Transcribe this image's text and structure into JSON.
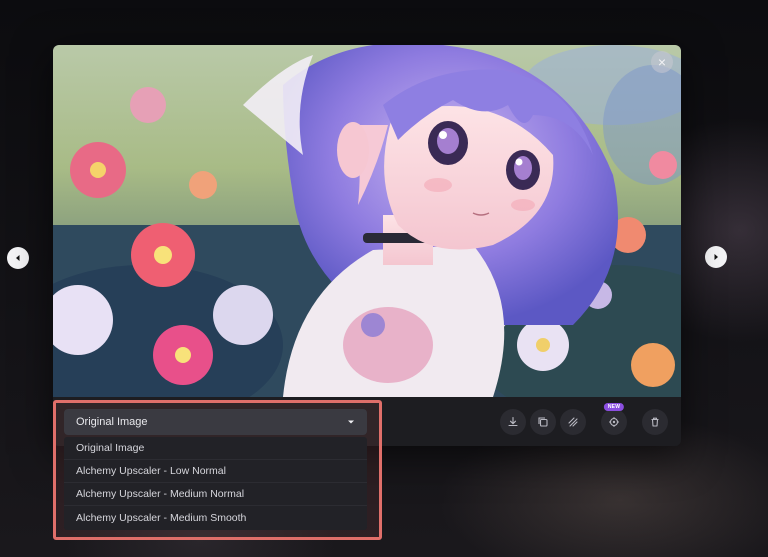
{
  "viewer": {
    "close_label": "×",
    "new_badge": "NEW",
    "icons": [
      "download-icon",
      "copy-icon",
      "remove-background-icon",
      "unzoom-icon",
      "trash-icon"
    ]
  },
  "upscale_dropdown": {
    "selected": "Original Image",
    "options": [
      {
        "label": "Original Image"
      },
      {
        "label": "Alchemy Upscaler - Low Normal"
      },
      {
        "label": "Alchemy Upscaler - Medium Normal"
      },
      {
        "label": "Alchemy Upscaler - Medium Smooth"
      }
    ]
  },
  "colors": {
    "highlight": "#e06f6a",
    "badge": "#8b4fe0",
    "panel": "#1d1d21"
  }
}
